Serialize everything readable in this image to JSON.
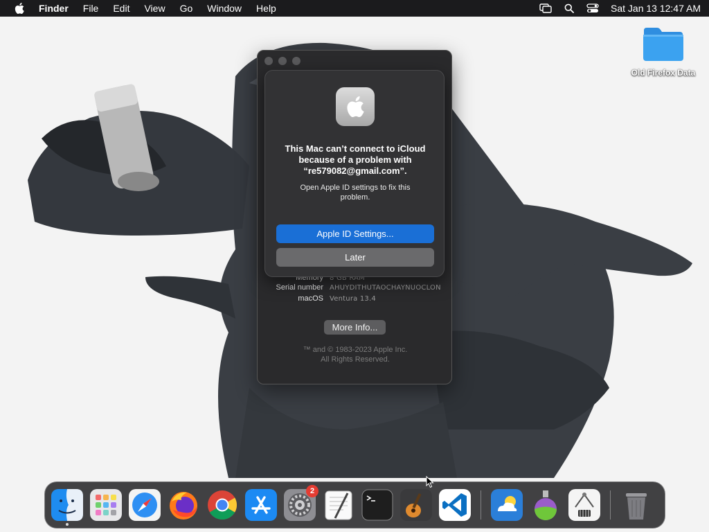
{
  "menubar": {
    "apple_icon": "apple-logo-icon",
    "app_name": "Finder",
    "menus": [
      "File",
      "Edit",
      "View",
      "Go",
      "Window",
      "Help"
    ],
    "status_icons": [
      "screen-mirroring-icon",
      "spotlight-search-icon",
      "control-center-icon"
    ],
    "clock": "Sat Jan 13  12:47 AM"
  },
  "desktop": {
    "folder_label": "Old Firefox Data",
    "folder_icon": "folder-icon"
  },
  "about_window": {
    "info": [
      {
        "key": "Memory",
        "value": "8 GB RAM"
      },
      {
        "key": "Serial number",
        "value": "AHUYDITHUTAOCHAYNUOCLON"
      },
      {
        "key": "macOS",
        "value": "Ventura 13.4"
      }
    ],
    "more_info_label": "More Info...",
    "copyright_line1": "™ and © 1983-2023 Apple Inc.",
    "copyright_line2": "All Rights Reserved."
  },
  "alert": {
    "icon": "apple-logo-icon",
    "title": "This Mac can’t connect to iCloud because of a problem with “re579082@gmail.com”.",
    "message": "Open Apple ID settings to fix this problem.",
    "primary_button": "Apple ID Settings...",
    "secondary_button": "Later"
  },
  "dock": {
    "apps": [
      {
        "name": "Finder",
        "icon": "finder-icon",
        "running": true
      },
      {
        "name": "Launchpad",
        "icon": "launchpad-icon"
      },
      {
        "name": "Safari",
        "icon": "safari-icon"
      },
      {
        "name": "Firefox",
        "icon": "firefox-icon"
      },
      {
        "name": "Google Chrome",
        "icon": "chrome-icon"
      },
      {
        "name": "App Store",
        "icon": "app-store-icon"
      },
      {
        "name": "System Settings",
        "icon": "system-settings-icon",
        "badge": "2"
      },
      {
        "name": "TextEdit",
        "icon": "textedit-icon"
      },
      {
        "name": "Terminal",
        "icon": "terminal-icon"
      },
      {
        "name": "GarageBand",
        "icon": "garageband-icon"
      },
      {
        "name": "Visual Studio Code",
        "icon": "vscode-icon"
      },
      {
        "name": "Weather",
        "icon": "weather-icon"
      },
      {
        "name": "Potion",
        "icon": "potion-icon"
      },
      {
        "name": "Archive Utility",
        "icon": "archive-utility-icon"
      },
      {
        "name": "Trash",
        "icon": "trash-icon"
      }
    ]
  },
  "colors": {
    "menubar_bg": "#1b1b1d",
    "alert_bg": "#323234",
    "primary_button": "#1a6fd6",
    "secondary_button": "#6a6a6c",
    "folder_blue": "#3ba2f0",
    "badge_red": "#e53c32"
  }
}
